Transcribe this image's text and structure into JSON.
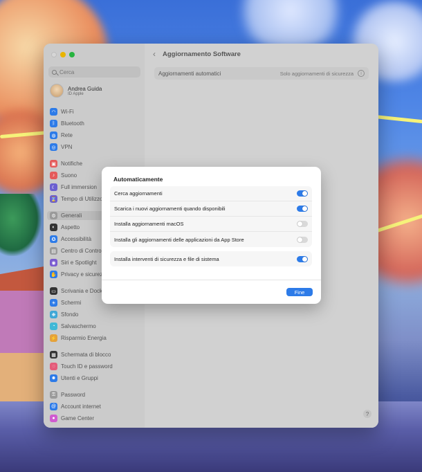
{
  "window": {
    "title": "Aggiornamento Software",
    "search_placeholder": "Cerca",
    "account": {
      "name": "Andrea Guida",
      "subtitle": "ID Apple"
    },
    "sidebar": [
      {
        "label": "Wi-Fi",
        "icon": "wifi-icon",
        "color": "#2d7be8",
        "glyph": "◠"
      },
      {
        "label": "Bluetooth",
        "icon": "bluetooth-icon",
        "color": "#2d7be8",
        "glyph": "ᛒ"
      },
      {
        "label": "Rete",
        "icon": "network-icon",
        "color": "#2d7be8",
        "glyph": "◍"
      },
      {
        "label": "VPN",
        "icon": "vpn-icon",
        "color": "#2d7be8",
        "glyph": "◎"
      },
      {
        "label": "Notifiche",
        "icon": "notifications-icon",
        "color": "#e45b5b",
        "glyph": "▣"
      },
      {
        "label": "Suono",
        "icon": "sound-icon",
        "color": "#e45b5b",
        "glyph": "♪"
      },
      {
        "label": "Full immersion",
        "icon": "focus-icon",
        "color": "#6b5fd0",
        "glyph": "☾"
      },
      {
        "label": "Tempo di Utilizzo",
        "icon": "screen-time-icon",
        "color": "#6b5fd0",
        "glyph": "⌛"
      },
      {
        "label": "Generali",
        "icon": "gear-icon",
        "color": "#9a9a9a",
        "glyph": "⚙"
      },
      {
        "label": "Aspetto",
        "icon": "appearance-icon",
        "color": "#333333",
        "glyph": "◐"
      },
      {
        "label": "Accessibilità",
        "icon": "accessibility-icon",
        "color": "#2d7be8",
        "glyph": "✪"
      },
      {
        "label": "Centro di Controllo",
        "icon": "control-center-icon",
        "color": "#9a9a9a",
        "glyph": "▤"
      },
      {
        "label": "Siri e Spotlight",
        "icon": "siri-icon",
        "color": "#7a5bd0",
        "glyph": "◉"
      },
      {
        "label": "Privacy e sicurezza",
        "icon": "privacy-icon",
        "color": "#2d7be8",
        "glyph": "✋"
      },
      {
        "label": "Scrivania e Dock",
        "icon": "dock-icon",
        "color": "#333333",
        "glyph": "▭"
      },
      {
        "label": "Schermi",
        "icon": "displays-icon",
        "color": "#2d7be8",
        "glyph": "☀"
      },
      {
        "label": "Sfondo",
        "icon": "wallpaper-icon",
        "color": "#3fa7d6",
        "glyph": "❋"
      },
      {
        "label": "Salvaschermo",
        "icon": "screensaver-icon",
        "color": "#3fb8d6",
        "glyph": "◔"
      },
      {
        "label": "Risparmio Energia",
        "icon": "energy-icon",
        "color": "#e4a13b",
        "glyph": "⚡"
      },
      {
        "label": "Schermata di blocco",
        "icon": "lock-screen-icon",
        "color": "#333333",
        "glyph": "▦"
      },
      {
        "label": "Touch ID e password",
        "icon": "touch-id-icon",
        "color": "#e45b7a",
        "glyph": "◌"
      },
      {
        "label": "Utenti e Gruppi",
        "icon": "users-icon",
        "color": "#2d7be8",
        "glyph": "☻"
      },
      {
        "label": "Password",
        "icon": "password-icon",
        "color": "#9a9a9a",
        "glyph": "⚿"
      },
      {
        "label": "Account internet",
        "icon": "internet-accounts-icon",
        "color": "#2d7be8",
        "glyph": "@"
      },
      {
        "label": "Game Center",
        "icon": "game-center-icon",
        "color": "#d05bd0",
        "glyph": "●"
      }
    ],
    "selected_sidebar": "Generali",
    "auto_updates_label": "Aggiornamenti automatici",
    "auto_updates_value": "Solo aggiornamenti di sicurezza"
  },
  "dialog": {
    "title": "Automaticamente",
    "options": [
      {
        "label": "Cerca aggiornamenti",
        "on": true
      },
      {
        "label": "Scarica i nuovi aggiornamenti quando disponibili",
        "on": true
      },
      {
        "label": "Installa aggiornamenti macOS",
        "on": false
      },
      {
        "label": "Installa gli aggiornamenti delle applicazioni da App Store",
        "on": false
      }
    ],
    "security_option": {
      "label": "Installa interventi di sicurezza e file di sistema",
      "on": true
    },
    "done_label": "Fine"
  },
  "colors": {
    "accent": "#2d7be8"
  }
}
